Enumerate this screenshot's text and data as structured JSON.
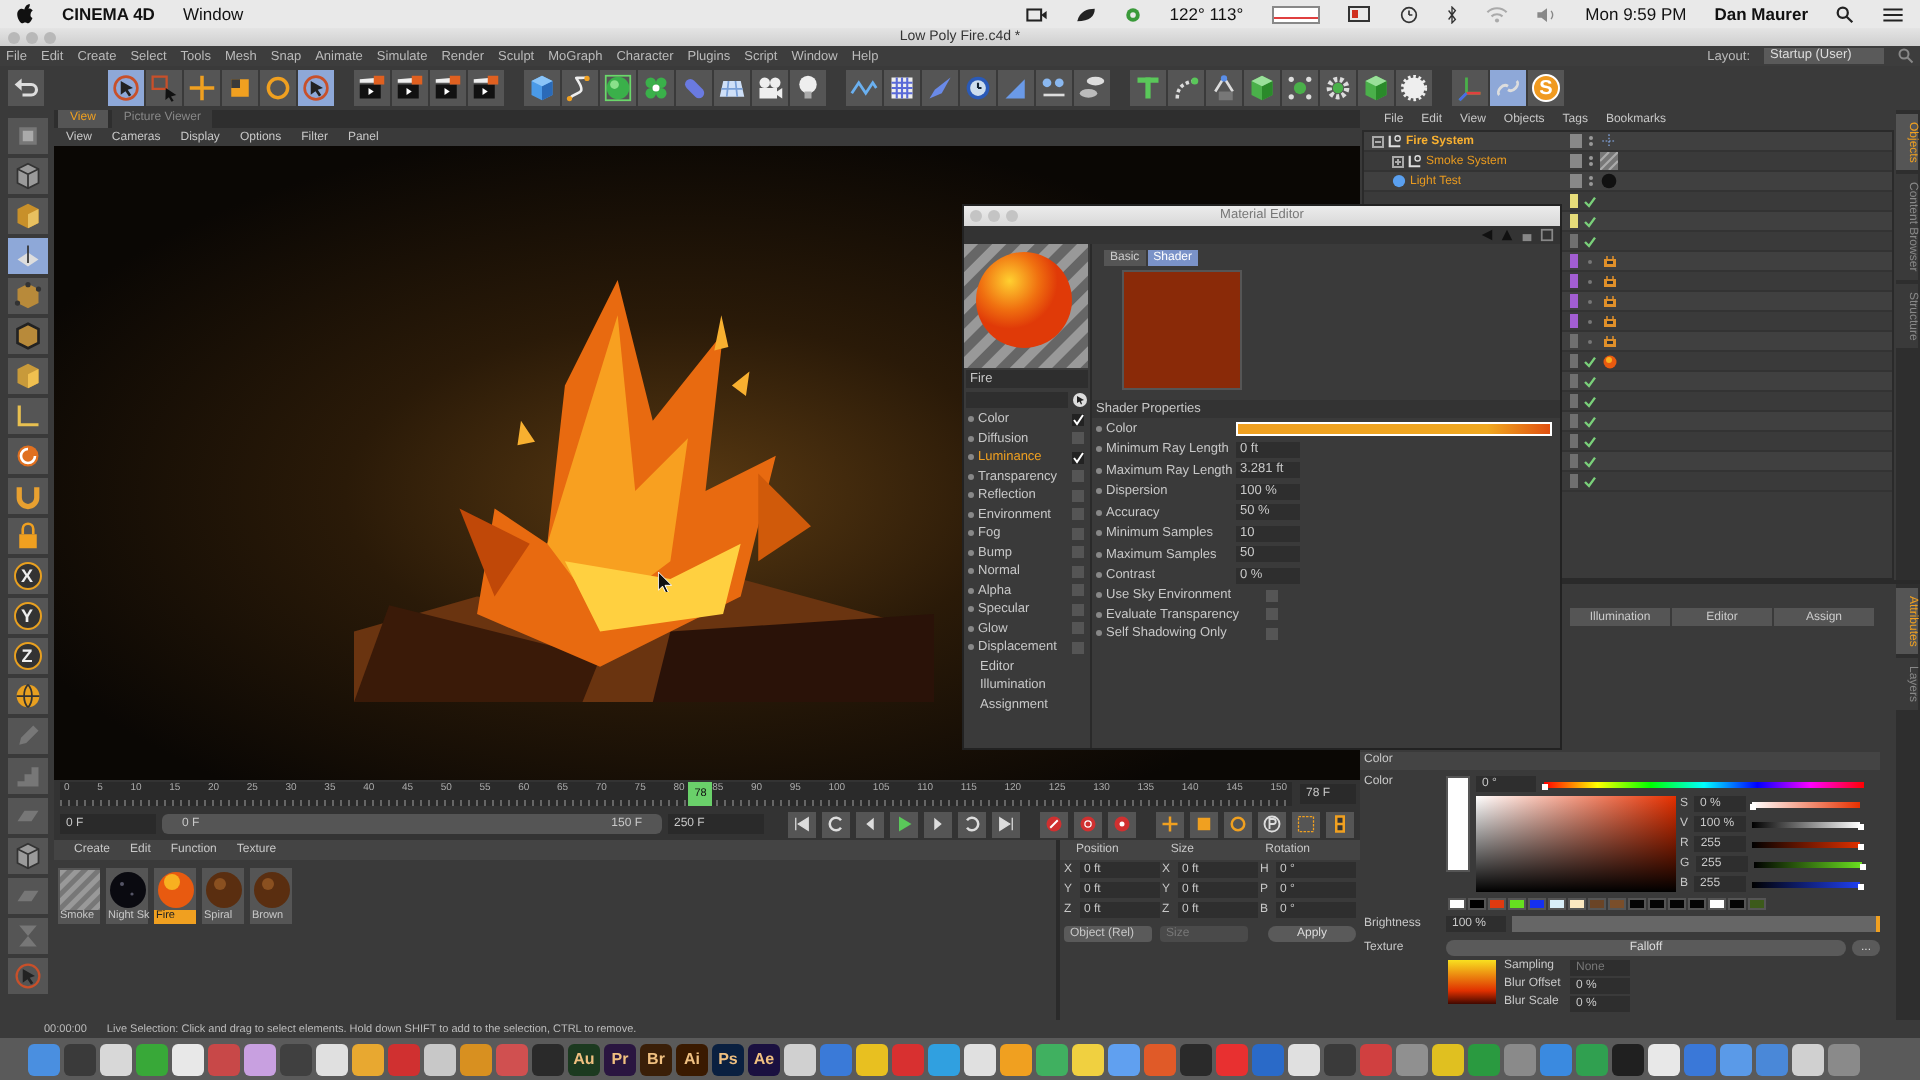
{
  "system_bar": {
    "app": "CINEMA 4D",
    "menu": [
      "Window"
    ],
    "temperature": "122° 113°",
    "clock": "Mon 9:59 PM",
    "user": "Dan Maurer"
  },
  "window": {
    "title": "Low Poly Fire.c4d *"
  },
  "menu": [
    "File",
    "Edit",
    "Create",
    "Select",
    "Tools",
    "Mesh",
    "Snap",
    "Animate",
    "Simulate",
    "Render",
    "Sculpt",
    "MoGraph",
    "Character",
    "Plugins",
    "Script",
    "Window",
    "Help"
  ],
  "layout": {
    "label": "Layout:",
    "value": "Startup (User)"
  },
  "toolbar": [
    {
      "items": [
        {
          "kind": "undo",
          "selected": false
        }
      ]
    },
    {
      "items": [
        {
          "kind": "select",
          "selected": true
        },
        {
          "kind": "rectsel",
          "selected": false
        },
        {
          "kind": "move",
          "selected": false
        },
        {
          "kind": "scale",
          "selected": false
        },
        {
          "kind": "rotate",
          "selected": false
        },
        {
          "kind": "select",
          "selected": true
        }
      ]
    },
    {
      "items": [
        {
          "kind": "render",
          "selected": false
        },
        {
          "kind": "render",
          "selected": false
        },
        {
          "kind": "render",
          "selected": false
        },
        {
          "kind": "render",
          "selected": false
        }
      ]
    },
    {
      "items": [
        {
          "kind": "cube",
          "selected": false
        },
        {
          "kind": "pen",
          "selected": false
        },
        {
          "kind": "sphere",
          "selected": false
        },
        {
          "kind": "clover",
          "selected": false
        },
        {
          "kind": "capsule",
          "selected": false
        },
        {
          "kind": "floor",
          "selected": false
        },
        {
          "kind": "camera",
          "selected": false
        },
        {
          "kind": "bulb",
          "selected": false
        }
      ]
    },
    {
      "items": [
        {
          "kind": "wave",
          "selected": false
        },
        {
          "kind": "grid",
          "selected": false
        },
        {
          "kind": "brush",
          "selected": false
        },
        {
          "kind": "clock",
          "selected": false
        },
        {
          "kind": "triangle",
          "selected": false
        },
        {
          "kind": "nodes",
          "selected": false
        },
        {
          "kind": "cylinders",
          "selected": false
        }
      ]
    },
    {
      "items": [
        {
          "kind": "texttool",
          "selected": false
        },
        {
          "kind": "bend",
          "selected": false
        },
        {
          "kind": "node",
          "selected": false
        },
        {
          "kind": "gcube",
          "selected": false
        },
        {
          "kind": "dots",
          "selected": false
        },
        {
          "kind": "gear",
          "selected": false
        },
        {
          "kind": "gcube",
          "selected": false
        },
        {
          "kind": "wgear",
          "selected": false
        }
      ]
    },
    {
      "items": [
        {
          "kind": "axis",
          "selected": false
        },
        {
          "kind": "link",
          "selected": true
        },
        {
          "kind": "logo",
          "label": "S",
          "selected": false
        }
      ]
    }
  ],
  "left_toolbar": [
    {
      "kind": "model",
      "selected": false
    },
    {
      "kind": "object",
      "selected": false
    },
    {
      "kind": "checker",
      "selected": false
    },
    {
      "kind": "workplane",
      "selected": true
    },
    {
      "kind": "points",
      "selected": false
    },
    {
      "kind": "edges",
      "selected": false
    },
    {
      "kind": "polys",
      "selected": false
    },
    {
      "kind": "enable",
      "selected": false
    },
    {
      "kind": "swirl",
      "selected": false
    },
    {
      "kind": "magnet",
      "selected": false
    },
    {
      "kind": "lock",
      "selected": false
    },
    {
      "kind": "axis",
      "label": "X",
      "selected": false
    },
    {
      "kind": "axis",
      "label": "Y",
      "selected": false
    },
    {
      "kind": "axis",
      "label": "Z",
      "selected": false
    },
    {
      "kind": "globe",
      "selected": false
    },
    {
      "kind": "pencil",
      "selected": false
    },
    {
      "kind": "stairs",
      "selected": false
    },
    {
      "kind": "plane",
      "selected": false
    },
    {
      "kind": "object",
      "selected": false
    },
    {
      "kind": "plane",
      "selected": false
    },
    {
      "kind": "hourglass",
      "selected": false
    },
    {
      "kind": "cursor",
      "selected": false
    }
  ],
  "viewport": {
    "tabs": [
      {
        "label": "View",
        "selected": true
      },
      {
        "label": "Picture Viewer",
        "selected": false
      }
    ],
    "menu": [
      "View",
      "Cameras",
      "Display",
      "Options",
      "Filter",
      "Panel"
    ]
  },
  "timeline": {
    "ticks": [
      "0",
      "5",
      "10",
      "15",
      "20",
      "25",
      "30",
      "35",
      "40",
      "45",
      "50",
      "55",
      "60",
      "65",
      "70",
      "75",
      "80",
      "85",
      "90",
      "95",
      "100",
      "105",
      "110",
      "115",
      "120",
      "125",
      "130",
      "135",
      "140",
      "145",
      "150"
    ],
    "playhead": {
      "label": "78",
      "level": 0.52
    },
    "frame": "78 F",
    "start": "0 F",
    "range": {
      "start": "0 F",
      "end": "150 F",
      "level": 1
    },
    "end": "250 F"
  },
  "material_manager": {
    "menu": [
      "Create",
      "Edit",
      "Function",
      "Texture"
    ],
    "materials": [
      {
        "name": "Smoke",
        "kind": "striped",
        "selected": false
      },
      {
        "name": "Night Sk",
        "kind": "dark",
        "selected": false
      },
      {
        "name": "Fire",
        "kind": "fire",
        "selected": true
      },
      {
        "name": "Spiral",
        "kind": "brown",
        "selected": false
      },
      {
        "name": "Brown",
        "kind": "brown",
        "selected": false
      }
    ]
  },
  "coordinates": {
    "headers": [
      "Position",
      "Size",
      "Rotation"
    ],
    "rows": [
      {
        "axis": "X",
        "position": "0 ft",
        "size_axis": "X",
        "size": "0 ft",
        "rotation_axis": "H",
        "rotation": "0 °"
      },
      {
        "axis": "Y",
        "position": "0 ft",
        "size_axis": "Y",
        "size": "0 ft",
        "rotation_axis": "P",
        "rotation": "0 °"
      },
      {
        "axis": "Z",
        "position": "0 ft",
        "size_axis": "Z",
        "size": "0 ft",
        "rotation_axis": "B",
        "rotation": "0 °"
      }
    ],
    "mode": "Object (Rel)",
    "size_mode": {
      "label": "Size",
      "disabled": true
    },
    "apply": "Apply"
  },
  "object_manager": {
    "menu": [
      "File",
      "Edit",
      "View",
      "Objects",
      "Tags",
      "Bookmarks"
    ],
    "objects": [
      {
        "name": "Fire System",
        "expanded": true,
        "kind": "dots",
        "children": [
          {
            "name": "Smoke System",
            "expanded": false,
            "kind": "striped"
          },
          {
            "name": "Light Test",
            "kind": "sphere"
          }
        ]
      }
    ],
    "tag_rows": [
      {
        "color": "#e6dc7a",
        "checked": true,
        "kind": "none"
      },
      {
        "color": "#e6dc7a",
        "checked": true,
        "kind": "none"
      },
      {
        "color": "#707070",
        "checked": true,
        "kind": "none"
      },
      {
        "color": "#a25ed2",
        "checked": false,
        "kind": "box"
      },
      {
        "color": "#a25ed2",
        "checked": false,
        "kind": "box"
      },
      {
        "color": "#a25ed2",
        "checked": false,
        "kind": "box"
      },
      {
        "color": "#a25ed2",
        "checked": false,
        "kind": "box"
      },
      {
        "color": "#707070",
        "checked": false,
        "kind": "box"
      },
      {
        "color": "#707070",
        "checked": true,
        "kind": "ball"
      },
      {
        "color": "#707070",
        "checked": true,
        "kind": "none"
      },
      {
        "color": "#707070",
        "checked": true,
        "kind": "none"
      },
      {
        "color": "#707070",
        "checked": true,
        "kind": "none"
      },
      {
        "color": "#707070",
        "checked": true,
        "kind": "none"
      },
      {
        "color": "#707070",
        "checked": true,
        "kind": "none"
      },
      {
        "color": "#707070",
        "checked": true,
        "kind": "none"
      }
    ],
    "side_tabs": [
      {
        "label": "Objects",
        "selected": true
      },
      {
        "label": "Content Browser",
        "selected": false
      },
      {
        "label": "Structure",
        "selected": false
      }
    ]
  },
  "attributes": {
    "buttons": [
      "Illumination",
      "Editor",
      "Assign"
    ],
    "section": "Color",
    "color_label": "Color",
    "hue": {
      "value": "0 °",
      "level": 0
    },
    "channels": [
      {
        "label": "S",
        "value": "0 %",
        "level": 0,
        "kind": "sat"
      },
      {
        "label": "V",
        "value": "100 %",
        "level": 1,
        "kind": "val"
      },
      {
        "label": "R",
        "value": "255",
        "level": 1,
        "kind": "red"
      },
      {
        "label": "G",
        "value": "255",
        "level": 1,
        "kind": "green"
      },
      {
        "label": "B",
        "value": "255",
        "level": 1,
        "kind": "blue"
      }
    ],
    "swatches": [
      {
        "color": "#ffffff"
      },
      {
        "color": "#000000"
      },
      {
        "color": "#e03a10"
      },
      {
        "color": "#66e020"
      },
      {
        "color": "#1530f0"
      },
      {
        "color": "#d8eef8"
      },
      {
        "color": "#fbe8c0"
      },
      {
        "color": "#6a4426"
      },
      {
        "color": "#7a4e2a"
      },
      {
        "color": "#050505"
      },
      {
        "color": "#050505"
      },
      {
        "color": "#050505"
      },
      {
        "color": "#050505"
      },
      {
        "color": "#ffffff"
      },
      {
        "color": "#050505"
      },
      {
        "color": "#3c5a1a"
      }
    ],
    "brightness": {
      "label": "Brightness",
      "value": "100 %",
      "level": 1
    },
    "texture": {
      "label": "Texture",
      "shader": "Falloff",
      "more": "..."
    },
    "sampling": {
      "label": "Sampling",
      "value": "None",
      "disabled": true
    },
    "blur_offset": {
      "label": "Blur Offset",
      "value": "0 %"
    },
    "blur_scale": {
      "label": "Blur Scale",
      "value": "0 %"
    },
    "side_tabs": [
      {
        "label": "Attributes",
        "selected": true
      },
      {
        "label": "Layers",
        "selected": false
      }
    ]
  },
  "material_editor": {
    "title": "Material Editor",
    "name": "Fire",
    "channels": [
      {
        "kind": "channel",
        "label": "Color",
        "checked": true,
        "selected": false
      },
      {
        "kind": "channel",
        "label": "Diffusion",
        "checked": false,
        "selected": false
      },
      {
        "kind": "channel",
        "label": "Luminance",
        "checked": true,
        "selected": true
      },
      {
        "kind": "channel",
        "label": "Transparency",
        "checked": false,
        "selected": false
      },
      {
        "kind": "channel",
        "label": "Reflection",
        "checked": false,
        "selected": false
      },
      {
        "kind": "channel",
        "label": "Environment",
        "checked": false,
        "selected": false
      },
      {
        "kind": "channel",
        "label": "Fog",
        "checked": false,
        "selected": false
      },
      {
        "kind": "channel",
        "label": "Bump",
        "checked": false,
        "selected": false
      },
      {
        "kind": "channel",
        "label": "Normal",
        "checked": false,
        "selected": false
      },
      {
        "kind": "channel",
        "label": "Alpha",
        "checked": false,
        "selected": false
      },
      {
        "kind": "channel",
        "label": "Specular",
        "checked": false,
        "selected": false
      },
      {
        "kind": "channel",
        "label": "Glow",
        "checked": false,
        "selected": false
      },
      {
        "kind": "channel",
        "label": "Displacement",
        "checked": false,
        "selected": false
      },
      {
        "kind": "page",
        "label": "Editor",
        "selected": false
      },
      {
        "kind": "page",
        "label": "Illumination",
        "selected": false
      },
      {
        "kind": "page",
        "label": "Assignment",
        "selected": false
      }
    ],
    "tabs": [
      {
        "label": "Basic",
        "selected": false
      },
      {
        "label": "Shader",
        "selected": true
      }
    ],
    "section": "Shader Properties",
    "params": [
      {
        "kind": "gradient",
        "label": "Color"
      },
      {
        "kind": "field",
        "label": "Minimum Ray Length",
        "value": "0 ft"
      },
      {
        "kind": "field",
        "label": "Maximum Ray Length",
        "value": "3.281 ft"
      },
      {
        "kind": "field",
        "label": "Dispersion",
        "value": "100 %"
      },
      {
        "kind": "field",
        "label": "Accuracy",
        "value": "50 %"
      },
      {
        "kind": "field",
        "label": "Minimum Samples",
        "value": "10"
      },
      {
        "kind": "field",
        "label": "Maximum Samples",
        "value": "50"
      },
      {
        "kind": "field",
        "label": "Contrast",
        "value": "0 %"
      },
      {
        "kind": "check",
        "label": "Use Sky Environment",
        "checked": false
      },
      {
        "kind": "check",
        "label": "Evaluate Transparency",
        "checked": false
      },
      {
        "kind": "check",
        "label": "Self Shadowing Only",
        "checked": false
      }
    ]
  },
  "status_bar": {
    "time": "00:00:00",
    "message": "Live Selection: Click and drag to select elements. Hold down SHIFT to add to the selection, CTRL to remove."
  },
  "dock": [
    {
      "kind": "icon",
      "color": "#4a8fe0"
    },
    {
      "kind": "icon",
      "color": "#3a3a3a"
    },
    {
      "kind": "icon",
      "color": "#d8d8d8"
    },
    {
      "kind": "icon",
      "color": "#38a838"
    },
    {
      "kind": "icon",
      "color": "#e8e8e8"
    },
    {
      "kind": "icon",
      "color": "#c84848"
    },
    {
      "kind": "icon",
      "color": "#c8a0e0"
    },
    {
      "kind": "icon",
      "color": "#404040"
    },
    {
      "kind": "icon",
      "color": "#e0e0e0"
    },
    {
      "kind": "icon",
      "color": "#e8a830"
    },
    {
      "kind": "icon",
      "color": "#d03030"
    },
    {
      "kind": "icon",
      "color": "#c8c8c8"
    },
    {
      "kind": "icon",
      "color": "#d89020"
    },
    {
      "kind": "icon",
      "color": "#d05050"
    },
    {
      "kind": "icon",
      "color": "#2a2a2a"
    },
    {
      "kind": "text",
      "label": "Au",
      "color": "#1c3a20"
    },
    {
      "kind": "text",
      "label": "Pr",
      "color": "#2a1640"
    },
    {
      "kind": "text",
      "label": "Br",
      "color": "#3a1f08"
    },
    {
      "kind": "text",
      "label": "Ai",
      "color": "#3a1a00"
    },
    {
      "kind": "text",
      "label": "Ps",
      "color": "#0a2040"
    },
    {
      "kind": "text",
      "label": "Ae",
      "color": "#1a1040"
    },
    {
      "kind": "icon",
      "color": "#d0d0d0"
    },
    {
      "kind": "icon",
      "color": "#3a7ad8"
    },
    {
      "kind": "icon",
      "color": "#e8c020"
    },
    {
      "kind": "icon",
      "color": "#d83030"
    },
    {
      "kind": "icon",
      "color": "#30a0e0"
    },
    {
      "kind": "icon",
      "color": "#e0e0e0"
    },
    {
      "kind": "icon",
      "color": "#f0a020"
    },
    {
      "kind": "icon",
      "color": "#40b060"
    },
    {
      "kind": "icon",
      "color": "#f0d040"
    },
    {
      "kind": "icon",
      "color": "#60a0f0"
    },
    {
      "kind": "icon",
      "color": "#e05a28"
    },
    {
      "kind": "icon",
      "color": "#2a2a2a"
    },
    {
      "kind": "icon",
      "color": "#e83030"
    },
    {
      "kind": "icon",
      "color": "#2a6ac8"
    },
    {
      "kind": "icon",
      "color": "#e0e0e0"
    },
    {
      "kind": "icon",
      "color": "#3a3a3a"
    },
    {
      "kind": "icon",
      "color": "#d04040"
    },
    {
      "kind": "icon",
      "color": "#909090"
    },
    {
      "kind": "icon",
      "color": "#e0c020"
    },
    {
      "kind": "icon",
      "color": "#2a9a40"
    },
    {
      "kind": "icon",
      "color": "#8a8a8a"
    },
    {
      "kind": "icon",
      "color": "#3a8ae0"
    },
    {
      "kind": "icon",
      "color": "#30a050"
    },
    {
      "kind": "icon",
      "color": "#202020"
    },
    {
      "kind": "icon",
      "color": "#e8e8e8"
    },
    {
      "kind": "icon",
      "color": "#3a78d8"
    },
    {
      "kind": "icon",
      "color": "#5a9ae8"
    },
    {
      "kind": "icon",
      "color": "#4a88d8"
    },
    {
      "kind": "icon",
      "color": "#d0d0d0"
    },
    {
      "kind": "icon",
      "color": "#8a8a8a"
    }
  ]
}
